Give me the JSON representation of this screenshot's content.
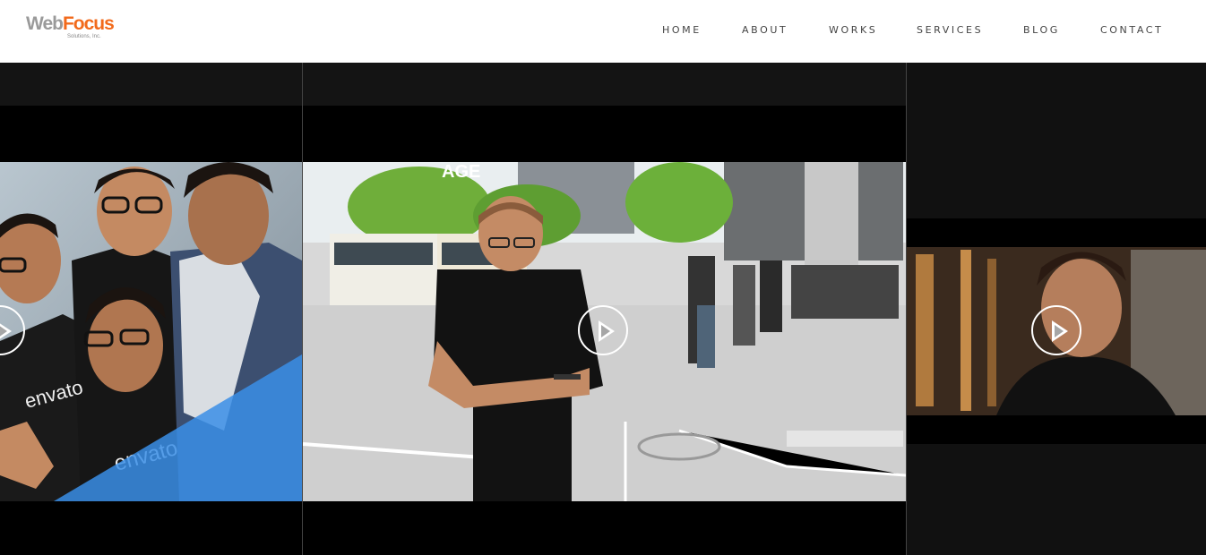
{
  "brand": {
    "name_part1": "Web",
    "name_part2": "Focus",
    "tagline": "Solutions, Inc."
  },
  "nav": {
    "items": [
      {
        "label": "HOME"
      },
      {
        "label": "ABOUT"
      },
      {
        "label": "WORKS"
      },
      {
        "label": "SERVICES"
      },
      {
        "label": "BLOG"
      },
      {
        "label": "CONTACT"
      }
    ]
  },
  "videos": [
    {
      "name": "team-envato-video",
      "shirt_text": "envato"
    },
    {
      "name": "street-phone-video",
      "sign_text": "AGE"
    },
    {
      "name": "portrait-man-video"
    }
  ],
  "colors": {
    "accent": "#f26a1b",
    "brand_gray": "#9a9a9a",
    "overlay_blue": "#3a8ee6"
  }
}
